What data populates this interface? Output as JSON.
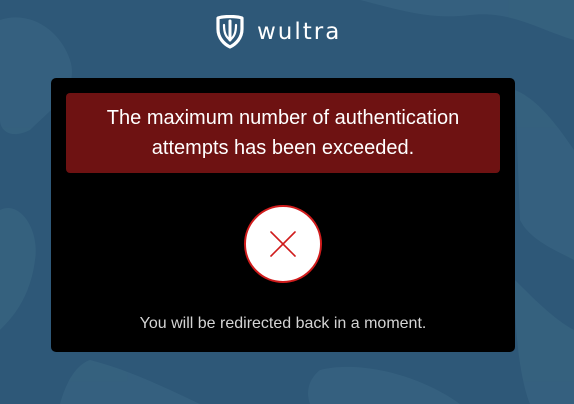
{
  "brand": {
    "name": "wultra",
    "logo_icon": "wultra-shield-logo-icon"
  },
  "dialog": {
    "error_message": "The maximum number of authentication attempts has been exceeded.",
    "status_icon": "close-x-icon",
    "redirect_message": "You will be redirected back in a moment."
  },
  "colors": {
    "background": "#2e5878",
    "card": "#000000",
    "alert": "#6e1212",
    "error_accent": "#d01c1c"
  }
}
